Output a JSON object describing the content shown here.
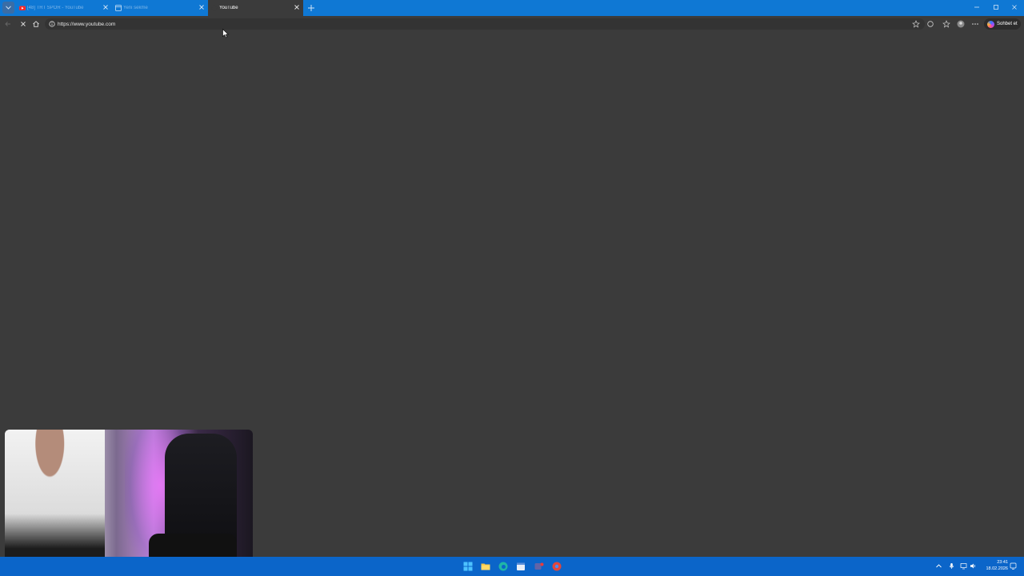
{
  "tabs": [
    {
      "title": "[48] TRT SPOR - YouTube",
      "favicon": "youtube-icon",
      "active": false
    },
    {
      "title": "Yeni sekme",
      "favicon": "newtab-icon",
      "active": false
    },
    {
      "title": "YouTube",
      "favicon": "loading-icon",
      "active": true
    }
  ],
  "address_bar": {
    "url": "https://www.youtube.com"
  },
  "toolbar": {
    "chat_label": "Sohbet et"
  },
  "taskbar": {
    "time": "23:41",
    "date": "18.02.2026",
    "pinned": [
      "windows-start-icon",
      "file-explorer-icon",
      "edge-icon",
      "calendar-icon",
      "teams-icon",
      "chrome-icon"
    ]
  },
  "colors": {
    "tab_strip": "#0f78d4",
    "taskbar": "#0b65c9",
    "page_bg": "#3b3b3b"
  }
}
